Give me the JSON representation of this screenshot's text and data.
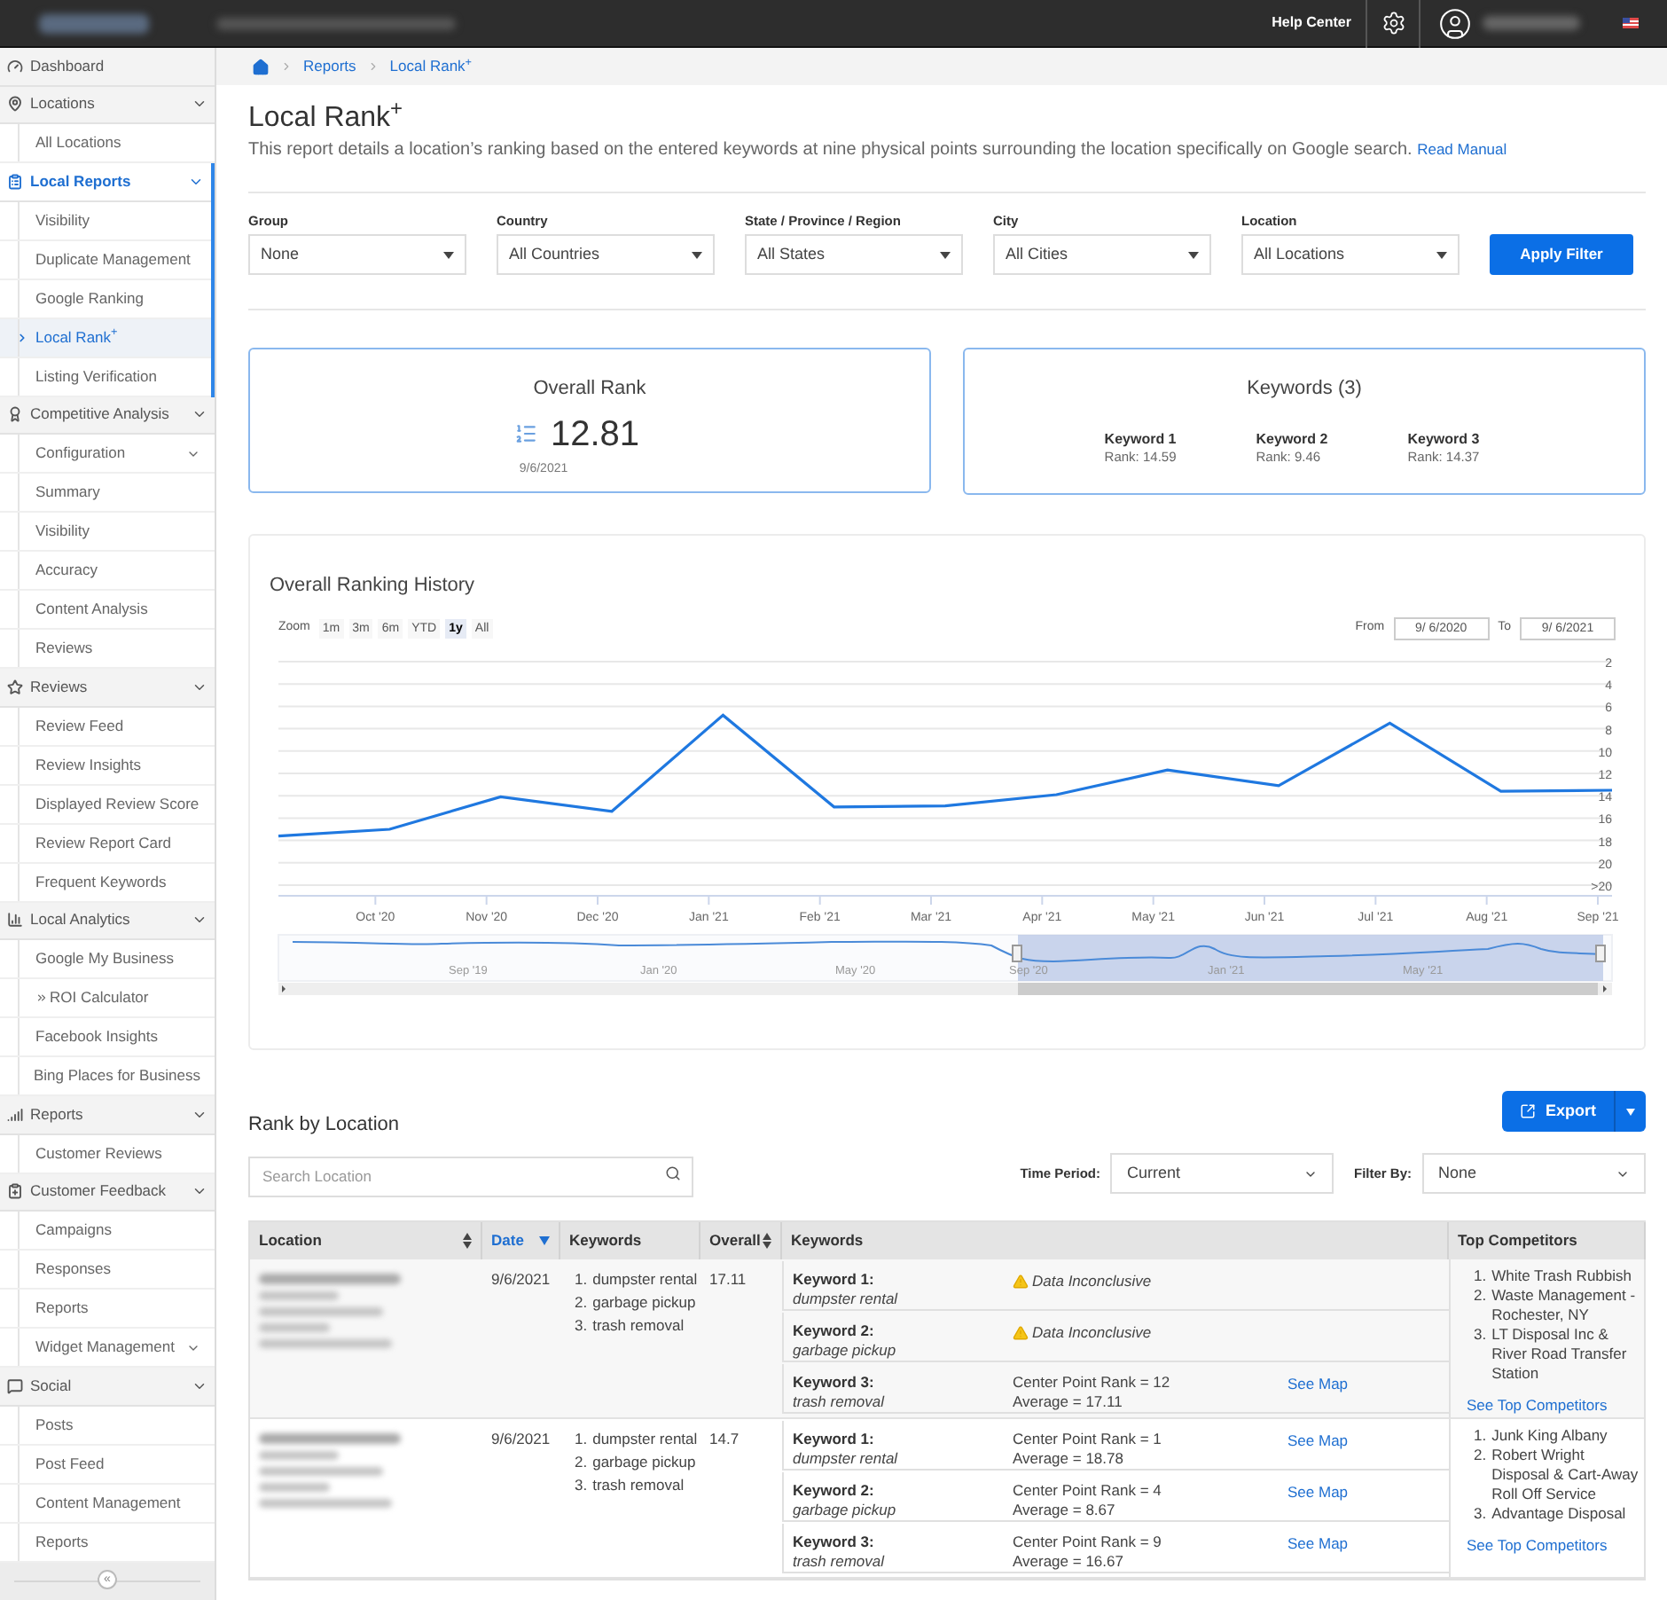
{
  "top_bar": {
    "help": "Help Center"
  },
  "sidebar": {
    "items": [
      {
        "label": "Dashboard",
        "selected": false
      },
      {
        "label": "Locations",
        "selected": false,
        "expanded": true,
        "children": [
          {
            "label": "All Locations",
            "kind": "page",
            "selected": false
          }
        ]
      },
      {
        "label": "Local Reports",
        "selected": true,
        "expanded": true,
        "children": [
          {
            "label": "Visibility",
            "kind": "page",
            "selected": false
          },
          {
            "label": "Duplicate Management",
            "kind": "page",
            "selected": false
          },
          {
            "label": "Google Ranking",
            "kind": "page",
            "selected": false
          },
          {
            "label": "Local Rank$^{+}$",
            "kind": "page",
            "selected": true
          },
          {
            "label": "Listing Verification",
            "kind": "page",
            "selected": false
          }
        ]
      },
      {
        "label": "Competitive Analysis",
        "selected": false,
        "expanded": true,
        "children": [
          {
            "label": "Configuration",
            "kind": "submenu",
            "selected": false
          },
          {
            "label": "Summary",
            "kind": "page",
            "selected": false
          },
          {
            "label": "Visibility",
            "kind": "page",
            "selected": false
          },
          {
            "label": "Accuracy",
            "kind": "page",
            "selected": false
          },
          {
            "label": "Content Analysis",
            "kind": "page",
            "selected": false
          },
          {
            "label": "Reviews",
            "kind": "page",
            "selected": false
          }
        ]
      },
      {
        "label": "Reviews",
        "selected": false,
        "expanded": true,
        "children": [
          {
            "label": "Review Feed",
            "kind": "page",
            "selected": false
          },
          {
            "label": "Review Insights",
            "kind": "page",
            "selected": false
          },
          {
            "label": "Displayed Review Score",
            "kind": "page",
            "selected": false
          },
          {
            "label": "Review Report Card",
            "kind": "page",
            "selected": false
          },
          {
            "label": "Frequent Keywords",
            "kind": "page",
            "selected": false
          }
        ]
      },
      {
        "label": "Local Analytics",
        "selected": false,
        "expanded": true,
        "children": [
          {
            "label": "Google My Business",
            "kind": "page",
            "selected": false
          },
          {
            "label": "ROI Calculator",
            "kind": "external",
            "selected": false
          },
          {
            "label": "Facebook Insights",
            "kind": "page",
            "selected": false
          },
          {
            "label": "Bing Places for Business",
            "kind": "page",
            "selected": false
          }
        ]
      },
      {
        "label": "Reports",
        "selected": false,
        "expanded": true,
        "children": [
          {
            "label": "Customer Reviews",
            "kind": "page",
            "selected": false
          }
        ]
      },
      {
        "label": "Customer Feedback",
        "selected": false,
        "expanded": true,
        "children": [
          {
            "label": "Campaigns",
            "kind": "page",
            "selected": false
          },
          {
            "label": "Responses",
            "kind": "page",
            "selected": false
          },
          {
            "label": "Reports",
            "kind": "page",
            "selected": false
          },
          {
            "label": "Widget Management",
            "kind": "submenu",
            "selected": false
          }
        ]
      },
      {
        "label": "Social",
        "selected": false,
        "expanded": true,
        "children": [
          {
            "label": "Posts",
            "kind": "page",
            "selected": false
          },
          {
            "label": "Post Feed",
            "kind": "page",
            "selected": false
          },
          {
            "label": "Content Management",
            "kind": "page",
            "selected": false
          },
          {
            "label": "Reports",
            "kind": "page",
            "selected": false
          }
        ]
      }
    ],
    "collapse": "«"
  },
  "breadcrumb": [
    "Reports",
    "Local Rank$^{+}$"
  ],
  "page": {
    "title": "Local Rank$^{+}$",
    "description": "This report details a location’s ranking based on the entered keywords at nine physical points surrounding the location specifically on Google search.",
    "manual_link": "Read Manual"
  },
  "filters": [
    {
      "label": "Group",
      "value": "None"
    },
    {
      "label": "Country",
      "value": "All Countries"
    },
    {
      "label": "State / Province / Region",
      "value": "All States"
    },
    {
      "label": "City",
      "value": "All Cities"
    },
    {
      "label": "Location",
      "value": "All Locations"
    }
  ],
  "apply_button": "Apply Filter",
  "overall_rank": {
    "title": "Overall Rank",
    "value": "12.81",
    "date": "9/6/2021"
  },
  "keywords_card": {
    "title": "Keywords (3)",
    "keywords": [
      {
        "name": "Keyword 1",
        "rank": "Rank: 14.59"
      },
      {
        "name": "Keyword 2",
        "rank": "Rank: 9.46"
      },
      {
        "name": "Keyword 3",
        "rank": "Rank: 14.37"
      }
    ]
  },
  "history": {
    "title": "Overall Ranking History",
    "zoom_label": "Zoom",
    "zoom": [
      {
        "label": "1m",
        "selected": false
      },
      {
        "label": "3m",
        "selected": false
      },
      {
        "label": "6m",
        "selected": false
      },
      {
        "label": "YTD",
        "selected": false
      },
      {
        "label": "1y",
        "selected": true
      },
      {
        "label": "All",
        "selected": false
      }
    ],
    "from_label": "From",
    "from": "9/ 6/2020",
    "to_label": "To",
    "to": "9/ 6/2021",
    "chart_data": {
      "type": "line",
      "categories": [
        null,
        "Oct '20",
        "Nov '20",
        "Dec '20",
        "Jan '21",
        "Feb '21",
        "Mar '21",
        "Apr '21",
        "May '21",
        "Jun '21",
        "Jul '21",
        "Aug '21",
        "Sep '21"
      ],
      "series": [
        {
          "color": "#1f78e0",
          "values": [
            17.6,
            17,
            14.1,
            15.4,
            6.8,
            15,
            14.9,
            13.9,
            11.7,
            13.1,
            7.5,
            13.6,
            13.5
          ]
        }
      ],
      "ylim": [
        22,
        2
      ],
      "grid": true,
      "yticks": [
        2,
        4,
        6,
        8,
        10,
        12,
        14,
        16,
        18,
        20,
        {
          "value": 22,
          "label": ">20"
        }
      ]
    },
    "navigator_labels": [
      "Sep '19",
      "Jan '20",
      "May '20",
      "Sep '20",
      "Jan '21",
      "May '21"
    ]
  },
  "rank_by_location": {
    "title": "Rank by Location",
    "export": "Export",
    "search_placeholder": "Search Location",
    "time_period_label": "Time Period:",
    "time_period": "Current",
    "filter_by_label": "Filter By:",
    "filter_by": "None",
    "columns": [
      {
        "label": "Location",
        "sortable": true,
        "selected": false
      },
      {
        "label": "Date",
        "sortable": true,
        "selected": true
      },
      {
        "label": "Keywords",
        "sortable": false,
        "selected": false
      },
      {
        "label": "Overall",
        "sortable": true,
        "selected": false
      },
      {
        "label": "Keywords",
        "sortable": false,
        "selected": false
      },
      {
        "label": "Top Competitors",
        "sortable": false,
        "selected": false
      }
    ],
    "rows": [
      {
        "date": "9/6/2021",
        "keywords": [
          {
            "num": "1.",
            "text": "dumpster rental"
          },
          {
            "num": "2.",
            "text": "garbage pickup"
          },
          {
            "num": "3.",
            "text": "trash removal"
          }
        ],
        "overall": "17.11",
        "results": [
          {
            "kind": "inconclusive",
            "label": "Keyword 1:",
            "term": "dumpster rental",
            "status": "Data Inconclusive"
          },
          {
            "kind": "inconclusive",
            "label": "Keyword 2:",
            "term": "garbage pickup",
            "status": "Data Inconclusive"
          },
          {
            "kind": "rank",
            "label": "Keyword 3:",
            "term": "trash removal",
            "center": "Center Point Rank = 12",
            "average": "Average = 17.11",
            "link": "See Map"
          }
        ],
        "competitors": [
          {
            "num": "1.",
            "text": "White Trash Rubbish"
          },
          {
            "num": "2.",
            "text": "Waste Management - Rochester, NY"
          },
          {
            "num": "3.",
            "text": "LT Disposal Inc & River Road Transfer Station"
          }
        ],
        "competitors_link": "See Top Competitors"
      },
      {
        "date": "9/6/2021",
        "keywords": [
          {
            "num": "1.",
            "text": "dumpster rental"
          },
          {
            "num": "2.",
            "text": "garbage pickup"
          },
          {
            "num": "3.",
            "text": "trash removal"
          }
        ],
        "overall": "14.7",
        "results": [
          {
            "kind": "rank",
            "label": "Keyword 1:",
            "term": "dumpster rental",
            "center": "Center Point Rank = 1",
            "average": "Average = 18.78",
            "link": "See Map"
          },
          {
            "kind": "rank",
            "label": "Keyword 2:",
            "term": "garbage pickup",
            "center": "Center Point Rank = 4",
            "average": "Average = 8.67",
            "link": "See Map"
          },
          {
            "kind": "rank",
            "label": "Keyword 3:",
            "term": "trash removal",
            "center": "Center Point Rank = 9",
            "average": "Average = 16.67",
            "link": "See Map"
          }
        ],
        "competitors": [
          {
            "num": "1.",
            "text": "Junk King Albany"
          },
          {
            "num": "2.",
            "text": "Robert Wright Disposal & Cart-Away Roll Off Service"
          },
          {
            "num": "3.",
            "text": "Advantage Disposal"
          }
        ],
        "competitors_link": "See Top Competitors"
      }
    ]
  }
}
